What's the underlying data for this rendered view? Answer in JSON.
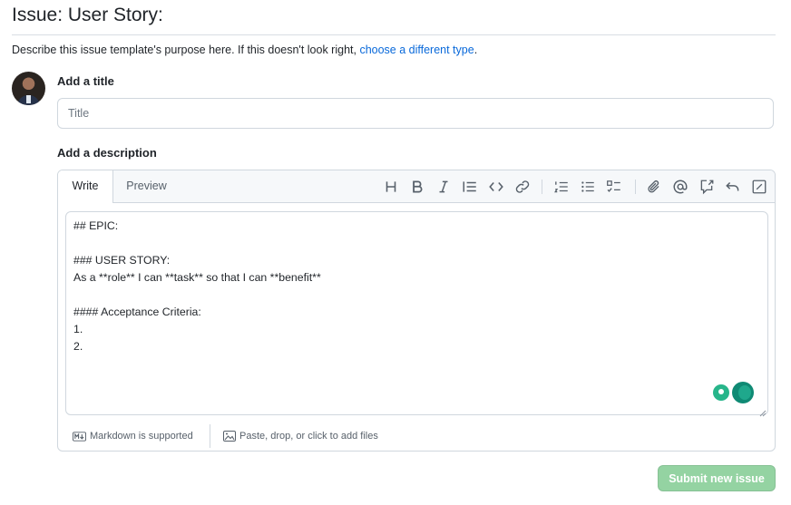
{
  "page": {
    "title": "Issue: User Story:",
    "intro_text": "Describe this issue template's purpose here. If this doesn't look right, ",
    "intro_link": "choose a different type",
    "intro_end": "."
  },
  "title_field": {
    "label": "Add a title",
    "placeholder": "Title",
    "value": ""
  },
  "description": {
    "label": "Add a description",
    "tabs": [
      "Write",
      "Preview"
    ],
    "active_tab": "Write",
    "toolbar_icons": [
      "heading-icon",
      "bold-icon",
      "italic-icon",
      "quote-icon",
      "code-icon",
      "link-icon",
      "ordered-list-icon",
      "unordered-list-icon",
      "task-list-icon",
      "attach-icon",
      "mention-icon",
      "reference-icon",
      "undo-icon",
      "fullscreen-icon"
    ],
    "body": "## EPIC:\n\n### USER STORY:\nAs a **role** I can **task** so that I can **benefit**\n\n#### Acceptance Criteria:\n1.\n2.",
    "markdown_note": "Markdown is supported",
    "attach_note": "Paste, drop, or click to add files"
  },
  "actions": {
    "submit_label": "Submit new issue"
  },
  "colors": {
    "link": "#0969da",
    "submit_disabled": "#94d3a2",
    "border": "#d0d7de"
  }
}
